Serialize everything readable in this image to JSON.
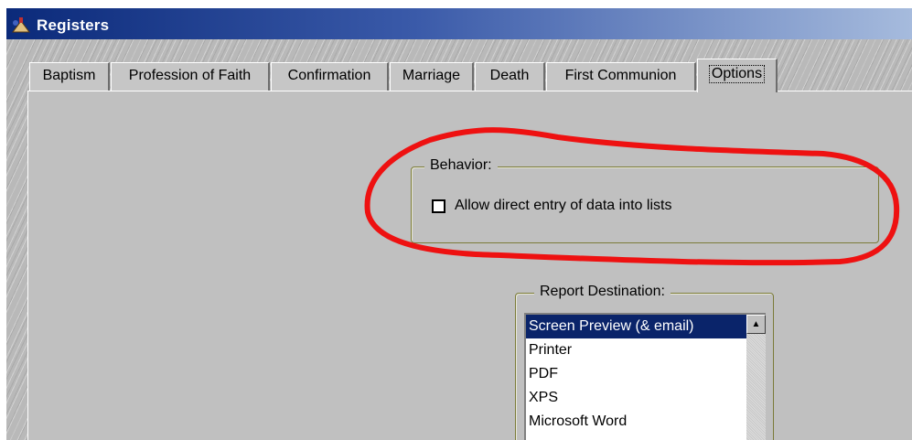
{
  "window": {
    "title": "Registers"
  },
  "tabs": [
    {
      "label": "Baptism"
    },
    {
      "label": "Profession of Faith"
    },
    {
      "label": "Confirmation"
    },
    {
      "label": "Marriage"
    },
    {
      "label": "Death"
    },
    {
      "label": "First Communion"
    },
    {
      "label": "Options",
      "active": true
    }
  ],
  "behavior": {
    "legend": "Behavior:",
    "allow_direct_entry": {
      "label": "Allow direct entry of data into lists",
      "checked": false
    }
  },
  "report_destination": {
    "legend": "Report Destination:",
    "selected": "Screen Preview (& email)",
    "options": [
      "Screen Preview (& email)",
      "Printer",
      "PDF",
      "XPS",
      "Microsoft Word"
    ]
  },
  "colors": {
    "selection": "#0a246a",
    "annotation_circle": "#ee1111",
    "title_bar": "#0b2a7a"
  }
}
